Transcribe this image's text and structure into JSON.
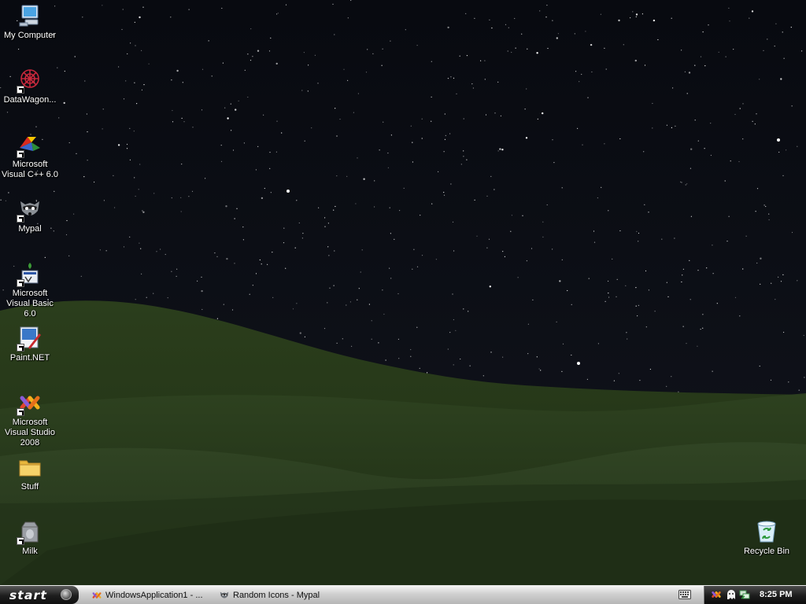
{
  "desktop": {
    "icons": [
      {
        "label": "My Computer",
        "icon": "my-computer-icon",
        "shortcut": false
      },
      {
        "label": "DataWagon...",
        "icon": "datawagon-icon",
        "shortcut": true
      },
      {
        "label": "Microsoft Visual C++ 6.0",
        "icon": "visual-cpp-icon",
        "shortcut": true
      },
      {
        "label": "Mypal",
        "icon": "mypal-raccoon-icon",
        "shortcut": true
      },
      {
        "label": "Microsoft Visual Basic 6.0",
        "icon": "visual-basic-icon",
        "shortcut": true
      },
      {
        "label": "Paint.NET",
        "icon": "paint-net-icon",
        "shortcut": true
      },
      {
        "label": "Microsoft Visual Studio 2008",
        "icon": "visual-studio-icon",
        "shortcut": true
      },
      {
        "label": "Stuff",
        "icon": "folder-icon",
        "shortcut": false
      },
      {
        "label": "Milk",
        "icon": "milk-carton-icon",
        "shortcut": true
      }
    ],
    "recycle_bin": {
      "label": "Recycle Bin",
      "icon": "recycle-bin-icon"
    }
  },
  "taskbar": {
    "start_label": "start",
    "tasks": [
      {
        "label": "WindowsApplication1 - ...",
        "icon": "visual-studio-icon"
      },
      {
        "label": "Random Icons - Mypal",
        "icon": "mypal-raccoon-icon"
      }
    ],
    "tray_icons": [
      "visual-studio-tray-icon",
      "ghost-tray-icon",
      "network-tray-icon"
    ],
    "clock": "8:25 PM"
  },
  "colors": {
    "sky": "#05070c",
    "hill": "#26381a",
    "taskbar": "#c8c8c8",
    "start_button": "#1d1d1d",
    "tray": "#1c1c1c"
  }
}
